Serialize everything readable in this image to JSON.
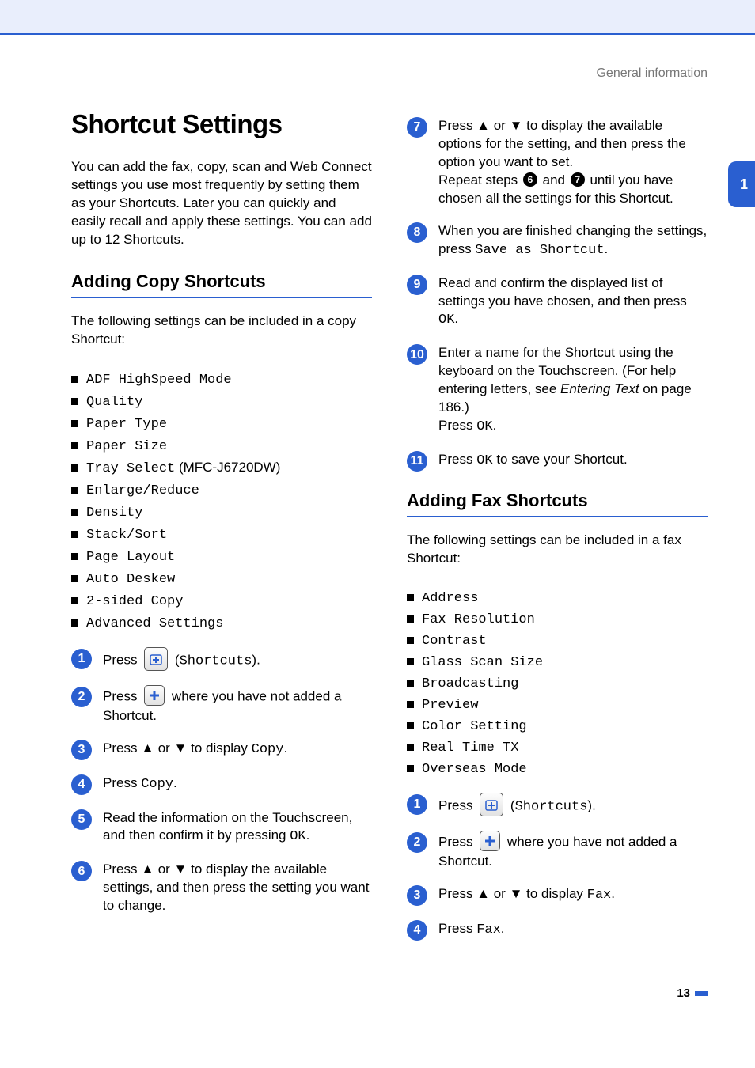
{
  "header": {
    "section": "General information"
  },
  "tab": {
    "label": "1"
  },
  "title": "Shortcut Settings",
  "intro": "You can add the fax, copy, scan and Web Connect settings you use most frequently by setting them as your Shortcuts. Later you can quickly and easily recall and apply these settings. You can add up to 12 Shortcuts.",
  "copy": {
    "heading": "Adding Copy Shortcuts",
    "lead": "The following settings can be included in a copy Shortcut:",
    "items": [
      {
        "t": "ADF HighSpeed Mode"
      },
      {
        "t": "Quality"
      },
      {
        "t": "Paper Type"
      },
      {
        "t": "Paper Size"
      },
      {
        "t": "Tray Select",
        "suffix": " (MFC-J6720DW)"
      },
      {
        "t": "Enlarge/Reduce"
      },
      {
        "t": "Density"
      },
      {
        "t": "Stack/Sort"
      },
      {
        "t": "Page Layout"
      },
      {
        "t": "Auto Deskew"
      },
      {
        "t": "2-sided Copy"
      },
      {
        "t": "Advanced Settings"
      }
    ],
    "steps": {
      "s1a": "Press ",
      "s1b": " (",
      "s1c": "Shortcuts",
      "s1d": ").",
      "s2a": "Press ",
      "s2b": " where you have not added a Shortcut.",
      "s3a": "Press ▲ or ▼ to display ",
      "s3b": "Copy",
      "s3c": ".",
      "s4a": "Press ",
      "s4b": "Copy",
      "s4c": ".",
      "s5a": "Read the information on the Touchscreen, and then confirm it by pressing ",
      "s5b": "OK",
      "s5c": ".",
      "s6": "Press ▲ or ▼ to display the available settings, and then press the setting you want to change."
    }
  },
  "right": {
    "s7a": "Press ▲ or ▼ to display the available options for the setting, and then press the option you want to set.",
    "s7b": "Repeat steps ",
    "s7c": " and ",
    "s7d": " until you have chosen all the settings for this Shortcut.",
    "ref6": "6",
    "ref7": "7",
    "s8a": "When you are finished changing the settings, press ",
    "s8b": "Save as Shortcut",
    "s8c": ".",
    "s9a": "Read and confirm the displayed list of settings you have chosen, and then press ",
    "s9b": "OK",
    "s9c": ".",
    "s10a": "Enter a name for the Shortcut using the keyboard on the Touchscreen. (For help entering letters, see ",
    "s10b": "Entering Text",
    "s10c": " on page 186.)",
    "s10d": "Press ",
    "s10e": "OK",
    "s10f": ".",
    "s11a": "Press ",
    "s11b": "OK",
    "s11c": " to save your Shortcut."
  },
  "fax": {
    "heading": "Adding Fax Shortcuts",
    "lead": "The following settings can be included in a fax Shortcut:",
    "items": [
      "Address",
      "Fax Resolution",
      "Contrast",
      "Glass Scan Size",
      "Broadcasting",
      "Preview",
      "Color Setting",
      "Real Time TX",
      "Overseas Mode"
    ],
    "steps": {
      "s1a": "Press ",
      "s1b": " (",
      "s1c": "Shortcuts",
      "s1d": ").",
      "s2a": "Press ",
      "s2b": " where you have not added a Shortcut.",
      "s3a": "Press ▲ or ▼ to display ",
      "s3b": "Fax",
      "s3c": ".",
      "s4a": "Press ",
      "s4b": "Fax",
      "s4c": "."
    }
  },
  "pagenum": "13"
}
